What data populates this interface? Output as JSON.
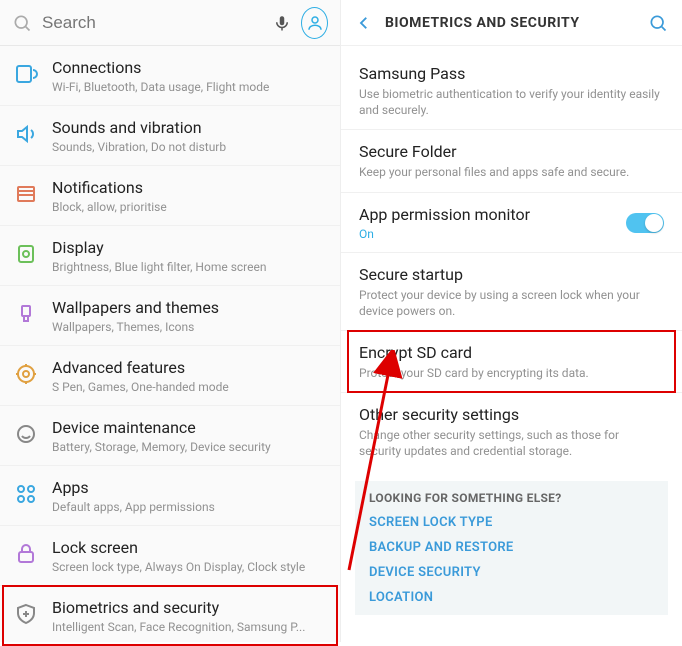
{
  "left": {
    "search_placeholder": "Search",
    "items": [
      {
        "title": "Connections",
        "sub": "Wi-Fi, Bluetooth, Data usage, Flight mode"
      },
      {
        "title": "Sounds and vibration",
        "sub": "Sounds, Vibration, Do not disturb"
      },
      {
        "title": "Notifications",
        "sub": "Block, allow, prioritise"
      },
      {
        "title": "Display",
        "sub": "Brightness, Blue light filter, Home screen"
      },
      {
        "title": "Wallpapers and themes",
        "sub": "Wallpapers, Themes, Icons"
      },
      {
        "title": "Advanced features",
        "sub": "S Pen, Games, One-handed mode"
      },
      {
        "title": "Device maintenance",
        "sub": "Battery, Storage, Memory, Device security"
      },
      {
        "title": "Apps",
        "sub": "Default apps, App permissions"
      },
      {
        "title": "Lock screen",
        "sub": "Screen lock type, Always On Display, Clock style"
      },
      {
        "title": "Biometrics and security",
        "sub": "Intelligent Scan, Face Recognition, Samsung P..."
      }
    ]
  },
  "right": {
    "header": "BIOMETRICS AND SECURITY",
    "items": [
      {
        "title": "Samsung Pass",
        "sub": "Use biometric authentication to verify your identity easily and securely."
      },
      {
        "title": "Secure Folder",
        "sub": "Keep your personal files and apps safe and secure."
      },
      {
        "title": "App permission monitor",
        "on": "On"
      },
      {
        "title": "Secure startup",
        "sub": "Protect your device by using a screen lock when your device powers on."
      },
      {
        "title": "Encrypt SD card",
        "sub": "Protect your SD card by encrypting its data."
      },
      {
        "title": "Other security settings",
        "sub": "Change other security settings, such as those for security updates and credential storage."
      }
    ],
    "looking": {
      "title": "LOOKING FOR SOMETHING ELSE?",
      "links": [
        "SCREEN LOCK TYPE",
        "BACKUP AND RESTORE",
        "DEVICE SECURITY",
        "LOCATION"
      ]
    }
  }
}
